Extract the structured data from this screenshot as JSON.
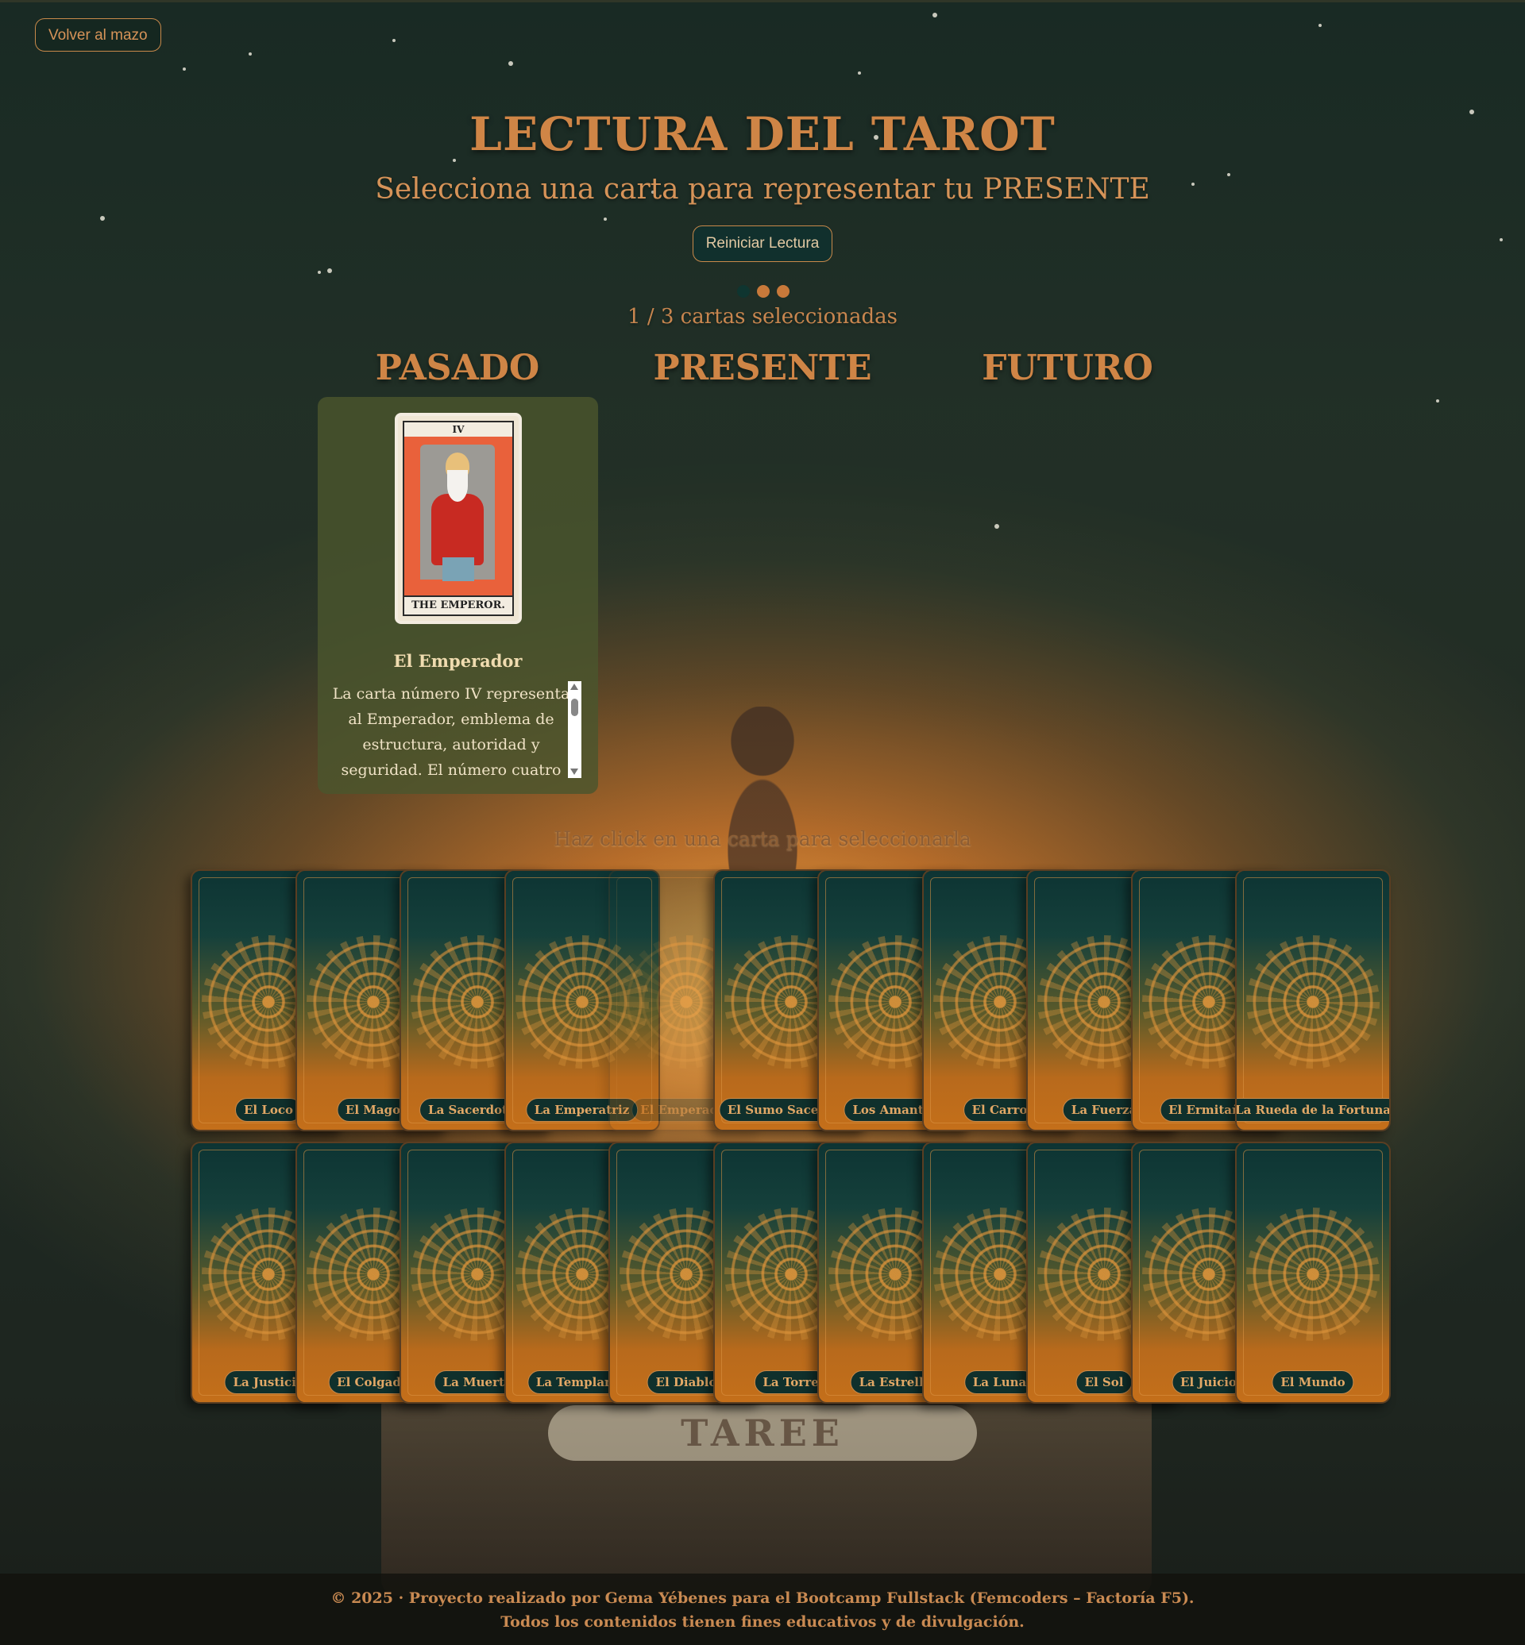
{
  "nav": {
    "back_label": "Volver al mazo"
  },
  "header": {
    "title": "LECTURA DEL TAROT",
    "subtitle": "Selecciona una carta para representar tu PRESENTE",
    "reset_label": "Reiniciar Lectura",
    "counter": "1 / 3 cartas seleccionadas",
    "progress": {
      "selected": 1,
      "total": 3
    }
  },
  "slots": {
    "past": "PASADO",
    "present": "PRESENTE",
    "future": "FUTURO"
  },
  "selected_card": {
    "image": {
      "numeral": "IV",
      "caption": "THE EMPEROR."
    },
    "name": "El Emperador",
    "description": "La carta número IV representa al Emperador, emblema de estructura, autoridad y seguridad. El número cuatro"
  },
  "deck": {
    "hint": "Haz click en una carta para seleccionarla",
    "row1": [
      "El Loco",
      "El Mago",
      "La Sacerdotisa",
      "La Emperatriz",
      "El Emperador",
      "El Sumo Sacerdote",
      "Los Amantes",
      "El Carro",
      "La Fuerza",
      "El Ermitaño",
      "La Rueda de la Fortuna"
    ],
    "row2": [
      "La Justicia",
      "El Colgado",
      "La Muerte",
      "La Templanza",
      "El Diablo",
      "La Torre",
      "La Estrella",
      "La Luna",
      "El Sol",
      "El Juicio",
      "El Mundo"
    ],
    "taken_card": "El Emperador"
  },
  "background": {
    "box_label": "TAREE"
  },
  "footer": {
    "line1": "© 2025 · Proyecto realizado por Gema Yébenes para el Bootcamp Fullstack (Femcoders – Factoría F5).",
    "line2": "Todos los contenidos tienen fines educativos y de divulgación."
  },
  "colors": {
    "accent": "#cf8546",
    "dark_teal": "#10302c",
    "panel": "#4b552d"
  }
}
